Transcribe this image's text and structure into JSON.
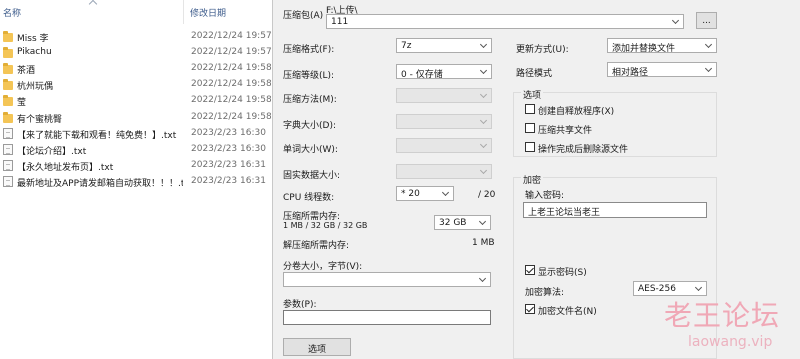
{
  "explorer": {
    "header_name": "名称",
    "header_date": "修改日期",
    "files": [
      {
        "icon": "folder",
        "name": "Miss 李",
        "date": "2022/12/24 19:57"
      },
      {
        "icon": "folder",
        "name": "Pikachu",
        "date": "2022/12/24 19:57"
      },
      {
        "icon": "folder",
        "name": "茶酒",
        "date": "2022/12/24 19:58"
      },
      {
        "icon": "folder",
        "name": "杭州玩偶",
        "date": "2022/12/24 19:58"
      },
      {
        "icon": "folder",
        "name": "莹",
        "date": "2022/12/24 19:58"
      },
      {
        "icon": "folder",
        "name": "有个蜜桃臀",
        "date": "2022/12/24 19:58"
      },
      {
        "icon": "txt",
        "name": "【来了就能下载和观看！纯免费！】.txt",
        "date": "2023/2/23 16:30"
      },
      {
        "icon": "txt",
        "name": "【论坛介绍】.txt",
        "date": "2023/2/23 16:30"
      },
      {
        "icon": "txt",
        "name": "【永久地址发布页】.txt",
        "date": "2023/2/23 16:31"
      },
      {
        "icon": "txt",
        "name": "最新地址及APP请发邮箱自动获取！！！.txt",
        "date": "2023/2/23 16:31"
      }
    ]
  },
  "dialog": {
    "archive_label": "压缩包(A)",
    "archive_path": "F:\\上传\\",
    "archive_value": "111",
    "browse_label": "...",
    "format_label": "压缩格式(F):",
    "format_value": "7z",
    "level_label": "压缩等级(L):",
    "level_value": "0 - 仅存储",
    "method_label": "压缩方法(M):",
    "dict_label": "字典大小(D):",
    "word_label": "单词大小(W):",
    "solid_label": "固实数据大小:",
    "cpu_label": "CPU 线程数:",
    "cpu_value": "* 20",
    "cpu_total": "/ 20",
    "mem_label": "压缩所需内存:",
    "mem_detail": "1 MB / 32 GB / 32 GB",
    "mem_value": "32 GB",
    "decomp_label": "解压缩所需内存:",
    "decomp_value": "1 MB",
    "split_label": "分卷大小，字节(V):",
    "split_value": "",
    "params_label": "参数(P):",
    "params_value": "",
    "options_button": "选项",
    "update_label": "更新方式(U):",
    "update_value": "添加并替换文件",
    "path_label": "路径模式",
    "path_value": "相对路径",
    "options_group": "选项",
    "opt_sfx": {
      "label": "创建自释放程序(X)",
      "checked": false
    },
    "opt_shared": {
      "label": "压缩共享文件",
      "checked": false
    },
    "opt_delete": {
      "label": "操作完成后删除源文件",
      "checked": false
    },
    "encrypt_group": "加密",
    "pwd_label": "输入密码:",
    "pwd_value": "上老王论坛当老王",
    "show_pwd": {
      "label": "显示密码(S)",
      "checked": true
    },
    "enc_method_label": "加密算法:",
    "enc_method_value": "AES-256",
    "enc_names": {
      "label": "加密文件名(N)",
      "checked": true
    }
  },
  "watermark": {
    "text": "老王论坛",
    "url": "laowang.vip"
  }
}
